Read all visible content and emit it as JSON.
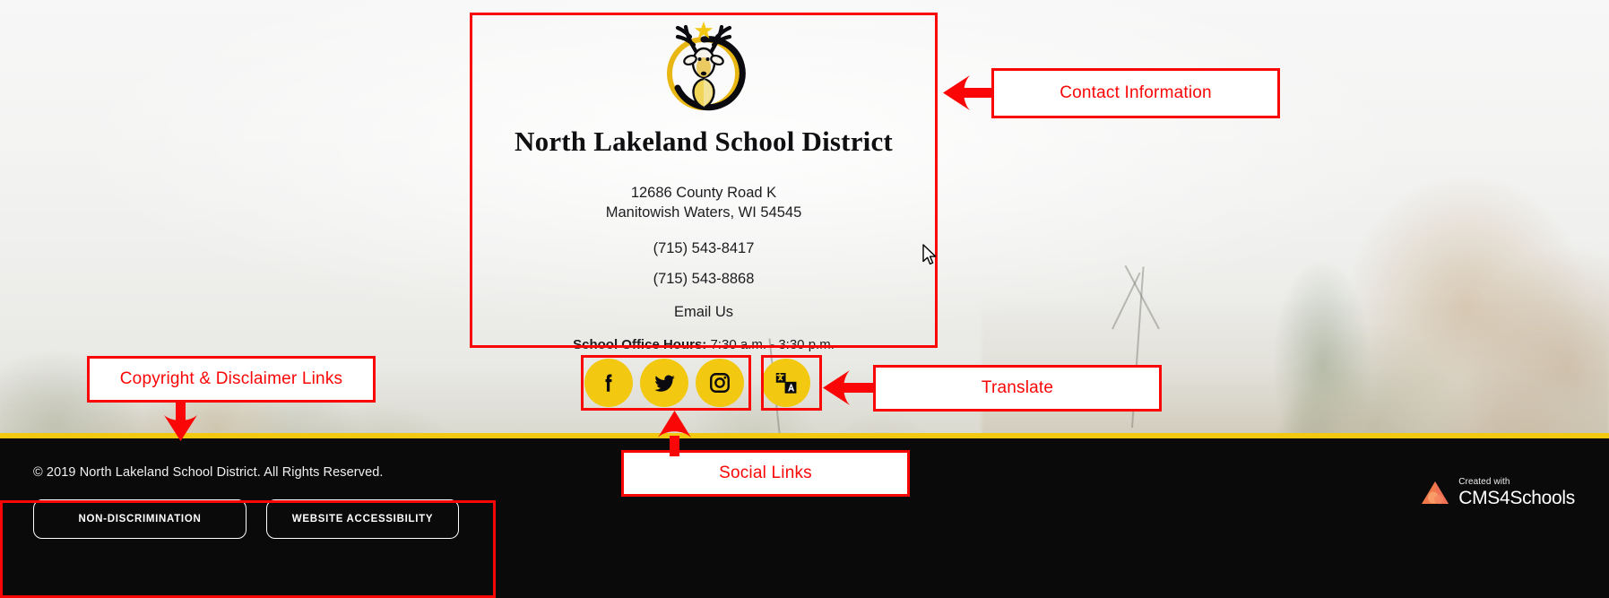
{
  "footer": {
    "logo_alt": "North Lakeland School District deer head logo",
    "district_name": "North Lakeland School District",
    "address_line1": "12686 County Road K",
    "address_line2": "Manitowish Waters, WI 54545",
    "phone_primary": "(715) 543-8417",
    "phone_secondary": "(715) 543-8868",
    "email_link_label": "Email Us",
    "office_hours_label": "School Office Hours:",
    "office_hours_value": " 7:30 a.m. - 3:30 p.m."
  },
  "social": {
    "items": [
      {
        "name": "facebook",
        "label": "Facebook"
      },
      {
        "name": "twitter",
        "label": "Twitter"
      },
      {
        "name": "instagram",
        "label": "Instagram"
      }
    ],
    "translate": {
      "name": "translate",
      "label": "Translate"
    }
  },
  "bottom_bar": {
    "copyright": "© 2019 North Lakeland School District. All Rights Reserved.",
    "links": [
      {
        "label": "NON-DISCRIMINATION"
      },
      {
        "label": "WEBSITE ACCESSIBILITY"
      }
    ],
    "cms": {
      "created_with": "Created with",
      "brand": "CMS4Schools"
    }
  },
  "annotations": [
    {
      "id": "contact-information",
      "label": "Contact Information"
    },
    {
      "id": "copyright-disclaimer-links",
      "label": "Copyright & Disclaimer Links"
    },
    {
      "id": "translate",
      "label": "Translate"
    },
    {
      "id": "social-links",
      "label": "Social Links"
    }
  ],
  "colors": {
    "accent_yellow": "#f2c811",
    "annotation_red": "#fb0606",
    "bar_black": "#0a0a0a",
    "text_dark": "#1d1d20"
  }
}
